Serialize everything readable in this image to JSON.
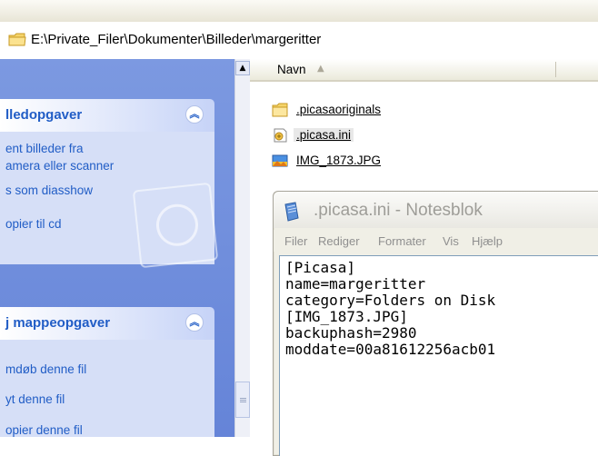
{
  "address": {
    "path": "E:\\Private_Filer\\Dokumenter\\Billeder\\margeritter"
  },
  "task_pane": {
    "picture_tasks": {
      "title": "lledopgaver",
      "items": [
        "ent billeder fra",
        "amera eller scanner",
        "s som diasshow",
        "opier til cd"
      ]
    },
    "file_tasks": {
      "title": "j mappeopgaver",
      "items": [
        "mdøb denne fil",
        "yt denne fil",
        "opier denne fil"
      ]
    }
  },
  "file_list": {
    "column_name": "Navn",
    "files": [
      {
        "name": ".picasaoriginals",
        "icon": "folder-icon"
      },
      {
        "name": ".picasa.ini",
        "icon": "ini-file-icon"
      },
      {
        "name": "IMG_1873.JPG",
        "icon": "image-file-icon"
      }
    ]
  },
  "notepad": {
    "title": ".picasa.ini - Notesblok",
    "menus": [
      "Filer",
      "Rediger",
      "Formater",
      "Vis",
      "Hjælp"
    ],
    "lines": [
      "[Picasa]",
      "name=margeritter",
      "category=Folders on Disk",
      "[IMG_1873.JPG]",
      "backuphash=2980",
      "moddate=00a81612256acb01"
    ]
  },
  "colors": {
    "task_link": "#215dc6",
    "task_pane_bg": "#6584d8"
  }
}
